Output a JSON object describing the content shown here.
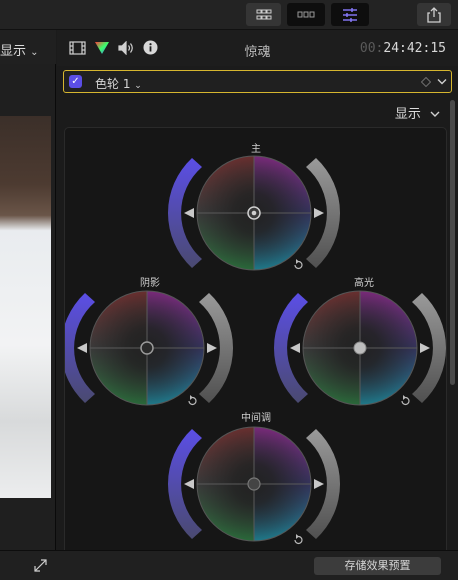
{
  "toolbar": {
    "icons": [
      "grid-view-icon",
      "filmstrip-icon",
      "inspector-sliders-icon",
      "share-icon"
    ],
    "accent_color": "#8a7cff"
  },
  "viewer": {
    "display_label": "显示"
  },
  "inspector": {
    "title": "惊魂",
    "timecode_dim": "00:",
    "timecode": "24:42:15",
    "tab_icons": [
      "film-icon",
      "color-icon",
      "audio-icon",
      "info-icon"
    ],
    "effect": {
      "enabled": true,
      "name": "色轮 1"
    },
    "display_label": "显示"
  },
  "color_wheels": {
    "master_label": "主",
    "shadows_label": "阴影",
    "highlights_label": "高光",
    "midtones_label": "中间调"
  },
  "footer": {
    "save_preset_label": "存储效果预置"
  }
}
